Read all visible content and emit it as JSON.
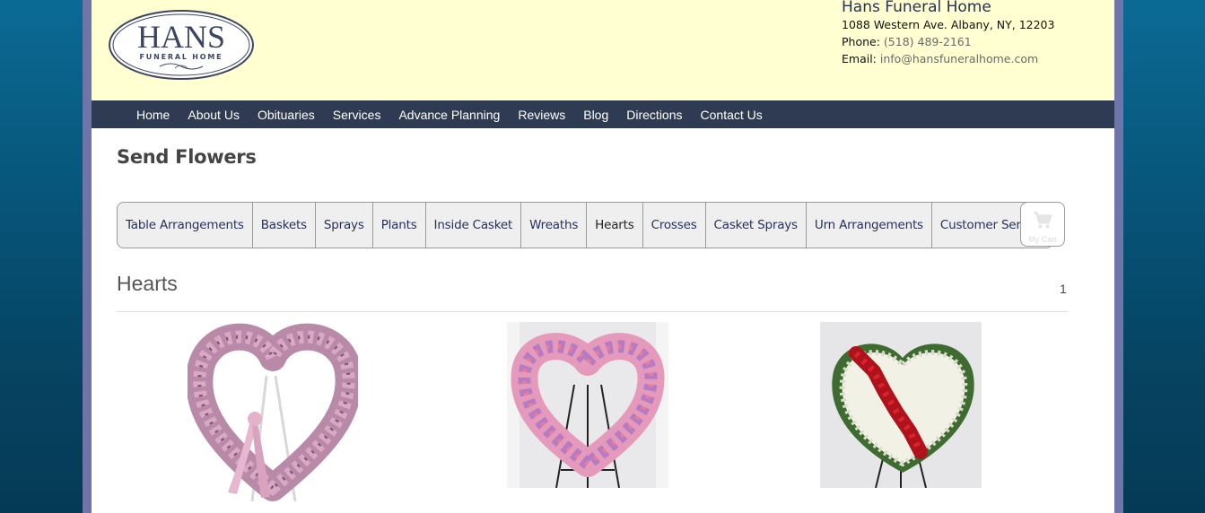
{
  "brand": {
    "logo_text": "HANS",
    "logo_sub": "FUNERAL HOME"
  },
  "contact": {
    "name": "Hans Funeral Home",
    "address": "1088 Western Ave. Albany, NY, 12203",
    "phone_label": "Phone:",
    "phone": "(518) 489-2161",
    "email_label": "Email:",
    "email": "info@hansfuneralhome.com"
  },
  "nav": {
    "items": [
      {
        "label": "Home"
      },
      {
        "label": "About Us"
      },
      {
        "label": "Obituaries"
      },
      {
        "label": "Services"
      },
      {
        "label": "Advance Planning"
      },
      {
        "label": "Reviews"
      },
      {
        "label": "Blog"
      },
      {
        "label": "Directions"
      },
      {
        "label": "Contact Us"
      }
    ]
  },
  "page_title": "Send Flowers",
  "tabs": {
    "items": [
      {
        "label": "Table Arrangements"
      },
      {
        "label": "Baskets"
      },
      {
        "label": "Sprays"
      },
      {
        "label": "Plants"
      },
      {
        "label": "Inside Casket"
      },
      {
        "label": "Wreaths"
      },
      {
        "label": "Hearts",
        "active": true
      },
      {
        "label": "Crosses"
      },
      {
        "label": "Casket Sprays"
      },
      {
        "label": "Urn Arrangements"
      },
      {
        "label": "Customer Service"
      }
    ]
  },
  "cart": {
    "label": "My Cart",
    "icon": "cart-icon"
  },
  "section": {
    "title": "Hearts",
    "page_count": "1"
  },
  "products": [
    {
      "image": "open-pink-heart-wreath"
    },
    {
      "image": "pink-gladiolus-heart-on-easel"
    },
    {
      "image": "white-heart-with-red-rose-band"
    }
  ],
  "colors": {
    "header_bg": "#ffffd2",
    "nav_bg": "#2f3b52",
    "frame": "#6e75a8",
    "background": "#07577c"
  }
}
